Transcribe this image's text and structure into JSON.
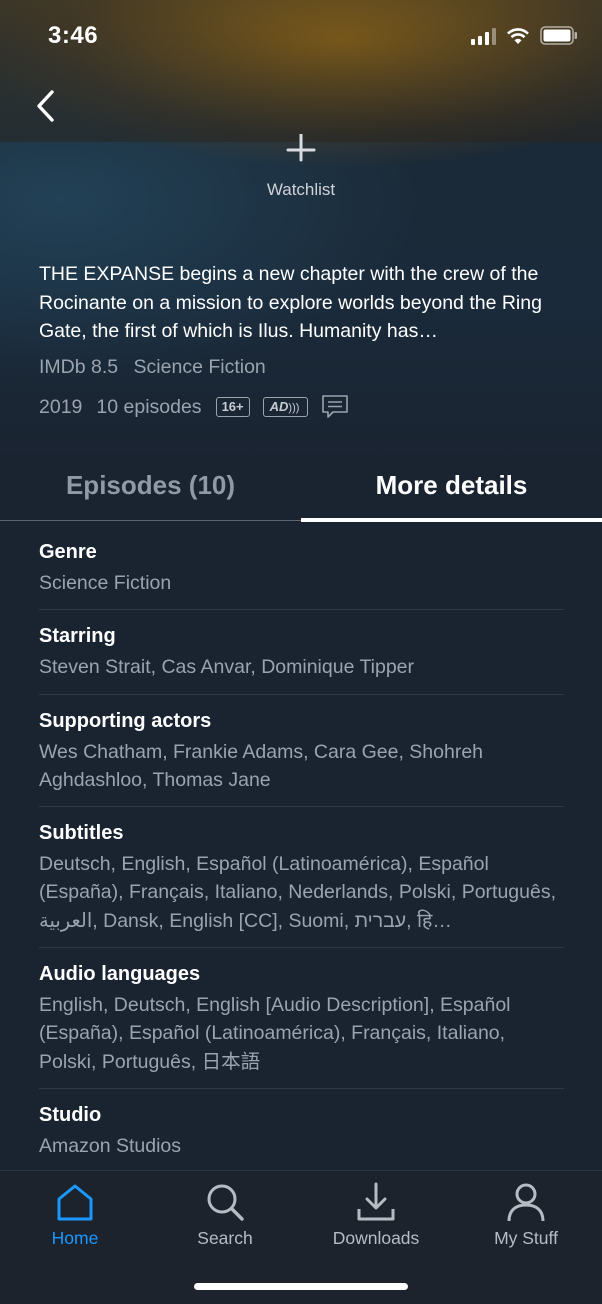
{
  "status_bar": {
    "time": "3:46"
  },
  "watchlist": {
    "label": "Watchlist"
  },
  "description": "THE EXPANSE begins a new chapter with the crew of the Rocinante on a mission to explore worlds beyond the Ring Gate, the first of which is Ilus. Humanity has…",
  "meta": {
    "imdb": "IMDb 8.5",
    "genre": "Science Fiction",
    "year": "2019",
    "episodes": "10 episodes",
    "rating_badge": "16+",
    "ad_badge": "AD"
  },
  "tabs": {
    "episodes": "Episodes (10)",
    "details": "More details",
    "active": "details"
  },
  "details": [
    {
      "title": "Genre",
      "value": "Science Fiction"
    },
    {
      "title": "Starring",
      "value": "Steven Strait, Cas Anvar, Dominique Tipper"
    },
    {
      "title": "Supporting actors",
      "value": "Wes Chatham, Frankie Adams, Cara Gee, Shohreh Aghdashloo, Thomas Jane"
    },
    {
      "title": "Subtitles",
      "value": "Deutsch, English, Español (Latinoamérica), Español (España), Français, Italiano, Nederlands, Polski, Português, العربية, Dansk, English [CC], Suomi, עברית, हि…"
    },
    {
      "title": "Audio languages",
      "value": "English, Deutsch, English [Audio Description], Español (España), Español (Latinoamérica), Français, Italiano, Polski, Português, 日本語"
    },
    {
      "title": "Studio",
      "value": "Amazon Studios"
    }
  ],
  "bottom_nav": [
    {
      "label": "Home",
      "icon": "home-icon",
      "active": true
    },
    {
      "label": "Search",
      "icon": "search-icon",
      "active": false
    },
    {
      "label": "Downloads",
      "icon": "download-icon",
      "active": false
    },
    {
      "label": "My Stuff",
      "icon": "profile-icon",
      "active": false
    }
  ],
  "colors": {
    "accent": "#1a98ff",
    "background": "#1a2431",
    "muted_text": "#9aa4ae"
  }
}
